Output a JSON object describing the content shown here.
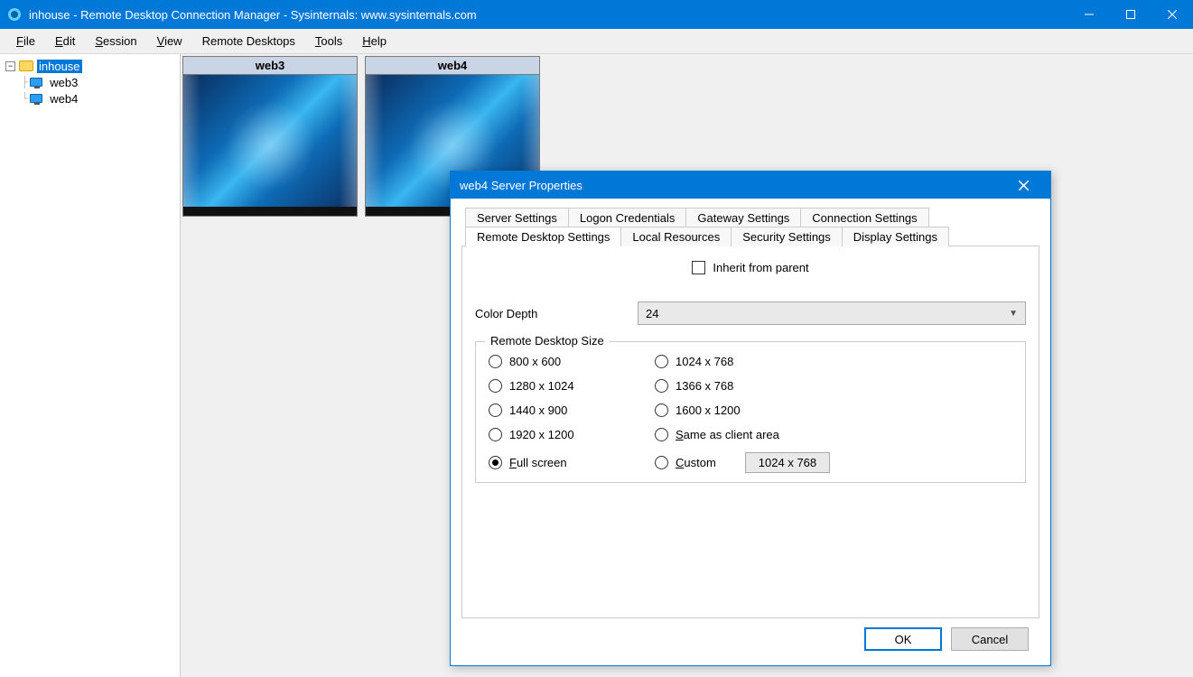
{
  "titlebar": {
    "title": "inhouse - Remote Desktop Connection Manager - Sysinternals: www.sysinternals.com"
  },
  "menubar": {
    "items": [
      "File",
      "Edit",
      "Session",
      "View",
      "Remote Desktops",
      "Tools",
      "Help"
    ]
  },
  "tree": {
    "root": "inhouse",
    "children": [
      "web3",
      "web4"
    ]
  },
  "thumbnails": [
    {
      "title": "web3"
    },
    {
      "title": "web4"
    }
  ],
  "dialog": {
    "title": "web4 Server Properties",
    "tabs_row1": [
      "Server Settings",
      "Logon Credentials",
      "Gateway Settings",
      "Connection Settings"
    ],
    "tabs_row2": [
      "Remote Desktop Settings",
      "Local Resources",
      "Security Settings",
      "Display Settings"
    ],
    "active_tab": "Remote Desktop Settings",
    "inherit_label": "Inherit from parent",
    "inherit_checked": false,
    "color_depth_label": "Color Depth",
    "color_depth_value": "24",
    "group_label": "Remote Desktop Size",
    "radios": [
      "800 x 600",
      "1024 x 768",
      "1280 x 1024",
      "1366 x 768",
      "1440 x 900",
      "1600 x 1200",
      "1920 x 1200",
      "Same as client area",
      "Full screen",
      "Custom"
    ],
    "selected_radio": "Full screen",
    "custom_value": "1024 x 768",
    "buttons": {
      "ok": "OK",
      "cancel": "Cancel"
    }
  }
}
